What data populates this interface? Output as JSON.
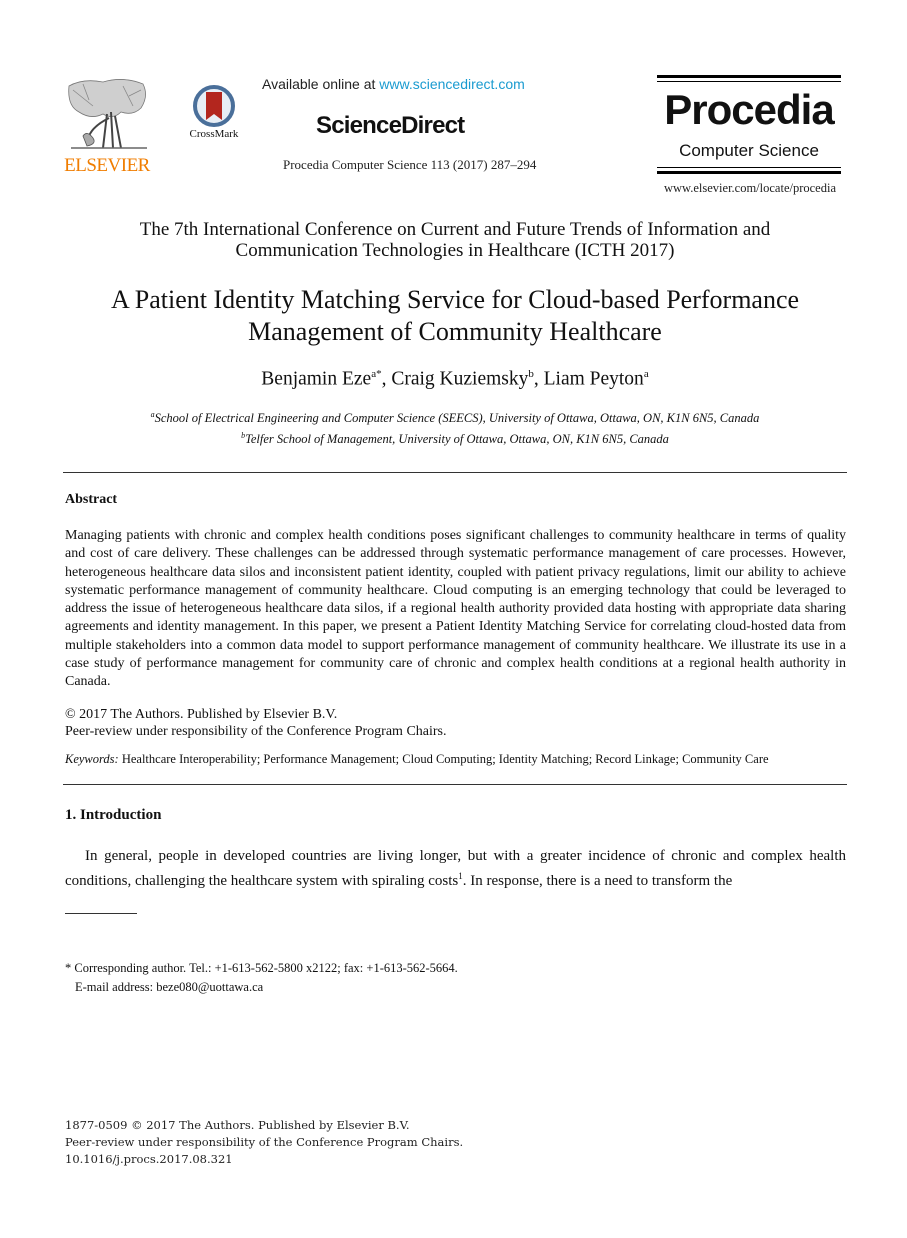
{
  "header": {
    "publisher_logo_text": "ELSEVIER",
    "crossmark_label": "CrossMark",
    "available_prefix": "Available online at ",
    "available_link": "www.sciencedirect.com",
    "brand": "ScienceDirect",
    "journal_reference": "Procedia Computer Science 113 (2017) 287–294",
    "journal_logo_title": "Procedia",
    "journal_logo_subtitle": "Computer Science",
    "journal_url": "www.elsevier.com/locate/procedia",
    "colors": {
      "elsevier_orange": "#f07d00",
      "link_blue": "#1a9bd0",
      "crossmark_red": "#b3261e",
      "crossmark_ring": "#4a6f9a"
    }
  },
  "conference": {
    "line1": "The 7th International Conference on Current and Future Trends of Information and",
    "line2": "Communication Technologies in Healthcare (ICTH 2017)"
  },
  "paper": {
    "title_line1": "A Patient Identity Matching Service for Cloud-based Performance",
    "title_line2": "Management of Community Healthcare",
    "authors": [
      {
        "name": "Benjamin Eze",
        "sup": "a*",
        "sep": ", "
      },
      {
        "name": "Craig Kuziemsky",
        "sup": "b",
        "sep": ", "
      },
      {
        "name": "Liam Peyton",
        "sup": "a",
        "sep": ""
      }
    ],
    "affiliations": [
      {
        "mark": "a",
        "text": "School of Electrical Engineering and Computer Science (SEECS), University of Ottawa, Ottawa, ON, K1N 6N5, Canada"
      },
      {
        "mark": "b",
        "text": "Telfer School of Management, University of Ottawa, Ottawa, ON, K1N 6N5, Canada"
      }
    ]
  },
  "abstract": {
    "heading": "Abstract",
    "body": "Managing patients with chronic and complex health conditions poses significant challenges to community healthcare in terms of quality and cost of care delivery. These challenges can be addressed through systematic performance management of care processes. However, heterogeneous healthcare data silos and inconsistent patient identity, coupled with patient privacy regulations, limit our ability to achieve systematic performance management of community healthcare. Cloud computing is an emerging technology that could be leveraged to address the issue of heterogeneous healthcare data silos, if a regional health authority provided data hosting with appropriate data sharing agreements and identity management. In this paper, we present a Patient Identity Matching Service for correlating cloud-hosted data from multiple stakeholders into a common data model to support performance management of community healthcare. We illustrate its use in a case study of performance management for community care of chronic and complex health conditions at a regional health authority in Canada.",
    "copyright": "© 2017 The Authors. Published by Elsevier B.V.",
    "peer_review": "Peer-review under responsibility of the Conference Program Chairs.",
    "keywords_label": "Keywords:",
    "keywords": "Healthcare Interoperability; Performance Management; Cloud Computing; Identity Matching; Record Linkage;  Community Care"
  },
  "introduction": {
    "heading": "1. Introduction",
    "text_before_ref": "In general, people in developed countries are living longer, but with a greater incidence of chronic and complex health conditions, challenging the healthcare system with spiraling costs",
    "ref": "1",
    "text_after_ref": ". In response, there is a need to transform the"
  },
  "footnote": {
    "corresponding": "* Corresponding author. Tel.: +1-613-562-5800 x2122; fax: +1-613-562-5664.",
    "email": "E-mail address: beze080@uottawa.ca"
  },
  "bottom": {
    "issn_line": "1877-0509 © 2017 The Authors. Published by Elsevier B.V.",
    "peer_line": "Peer-review under responsibility of the Conference Program Chairs.",
    "doi": "10.1016/j.procs.2017.08.321"
  }
}
